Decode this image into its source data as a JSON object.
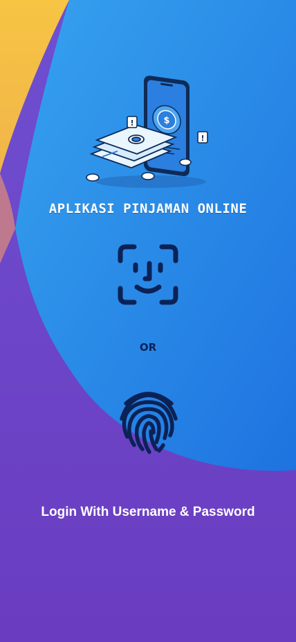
{
  "app": {
    "title": "APLIKASI PINJAMAN ONLINE"
  },
  "auth": {
    "face_icon": "face-id-icon",
    "separator": "OR",
    "fingerprint_icon": "fingerprint-icon",
    "login_link": "Login With Username & Password"
  },
  "illustration": {
    "icon": "phone-money-illustration",
    "currency_symbol": "$"
  },
  "colors": {
    "yellow": "#f5c242",
    "blue": "#2a86e4",
    "purple": "#6a42c4",
    "navy": "#0b2256",
    "white": "#ffffff"
  }
}
